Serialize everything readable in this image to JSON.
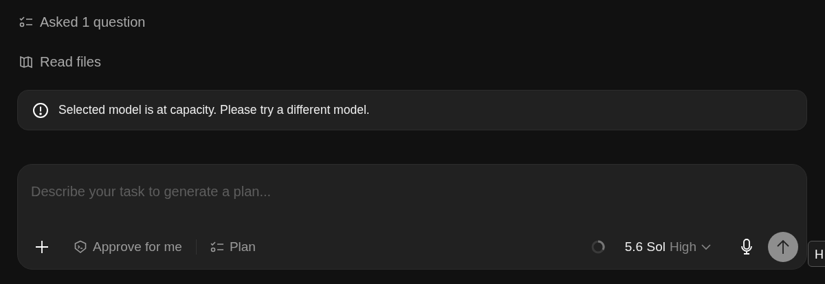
{
  "activity": [
    {
      "kind": "question",
      "label": "Asked 1 question"
    },
    {
      "kind": "files",
      "label": "Read files"
    }
  ],
  "alert": {
    "message": "Selected model is at capacity. Please try a different model."
  },
  "composer": {
    "placeholder": "Describe your task to generate a plan...",
    "approve_label": "Approve for me",
    "plan_label": "Plan",
    "model": "5.6 Sol",
    "effort": "High"
  },
  "tooltip": {
    "label": "H"
  }
}
